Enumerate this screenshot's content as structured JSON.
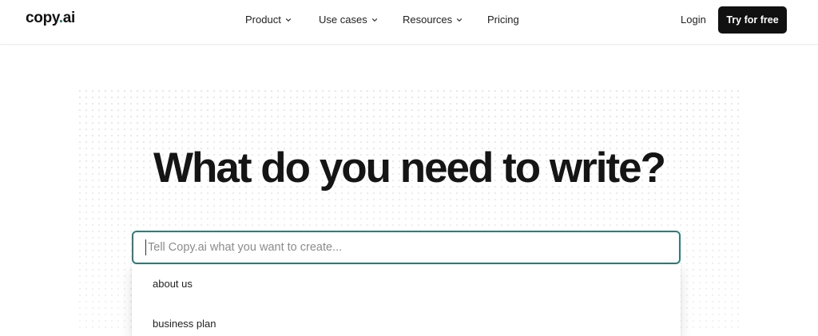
{
  "header": {
    "logo_text": "copy",
    "logo_dot": ".",
    "logo_suffix": "ai",
    "nav": [
      {
        "label": "Product",
        "has_dropdown": true
      },
      {
        "label": "Use cases",
        "has_dropdown": true
      },
      {
        "label": "Resources",
        "has_dropdown": true
      },
      {
        "label": "Pricing",
        "has_dropdown": false
      }
    ],
    "login_label": "Login",
    "cta_label": "Try for free"
  },
  "hero": {
    "headline": "What do you need to write?",
    "search_placeholder": "Tell Copy.ai what you want to create...",
    "search_value": ""
  },
  "suggestions": [
    "about us",
    "business plan"
  ],
  "colors": {
    "accent": "#2a7f7b",
    "cta_bg": "#111111",
    "text": "#151515"
  }
}
